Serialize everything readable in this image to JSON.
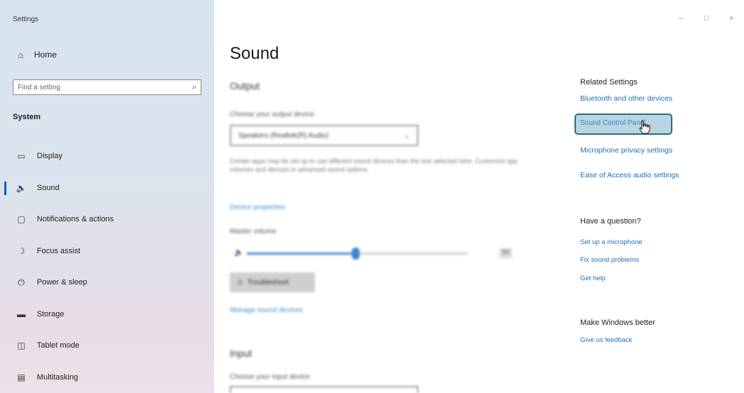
{
  "window": {
    "title": "Settings",
    "controls": [
      "–",
      "□",
      "×"
    ]
  },
  "sidebar": {
    "home_label": "Home",
    "search_placeholder": "Find a setting",
    "section_title": "System",
    "items": [
      {
        "label": "Display",
        "icon": "display-icon"
      },
      {
        "label": "Sound",
        "icon": "sound-icon",
        "selected": true
      },
      {
        "label": "Notifications & actions",
        "icon": "notifications-icon"
      },
      {
        "label": "Focus assist",
        "icon": "focus-assist-icon"
      },
      {
        "label": "Power & sleep",
        "icon": "power-icon"
      },
      {
        "label": "Storage",
        "icon": "storage-icon"
      },
      {
        "label": "Tablet mode",
        "icon": "tablet-mode-icon"
      },
      {
        "label": "Multitasking",
        "icon": "multitasking-icon"
      }
    ]
  },
  "main": {
    "title": "Sound",
    "output_heading": "Output",
    "output_device_label": "Choose your output device",
    "output_device_value": "Speakers (Realtek(R) Audio)",
    "description": "Certain apps may be set up to use different sound devices than the one selected here. Customize app volumes and devices in advanced sound options.",
    "properties_link": "Device properties",
    "volume_label": "Master volume",
    "volume_value": 50,
    "troubleshoot_label": "Troubleshoot",
    "manage_devices_link": "Manage sound devices",
    "input_heading": "Input",
    "input_device_label": "Choose your input device"
  },
  "related": {
    "heading": "Related Settings",
    "links": [
      "Bluetooth and other devices",
      "Sound Control Panel",
      "Microphone privacy settings",
      "Ease of Access audio settings"
    ]
  },
  "question": {
    "heading": "Have a question?",
    "links": [
      "Set up a microphone",
      "Fix sound problems",
      "Get help"
    ]
  },
  "better": {
    "heading": "Make Windows better",
    "link": "Give us feedback"
  }
}
